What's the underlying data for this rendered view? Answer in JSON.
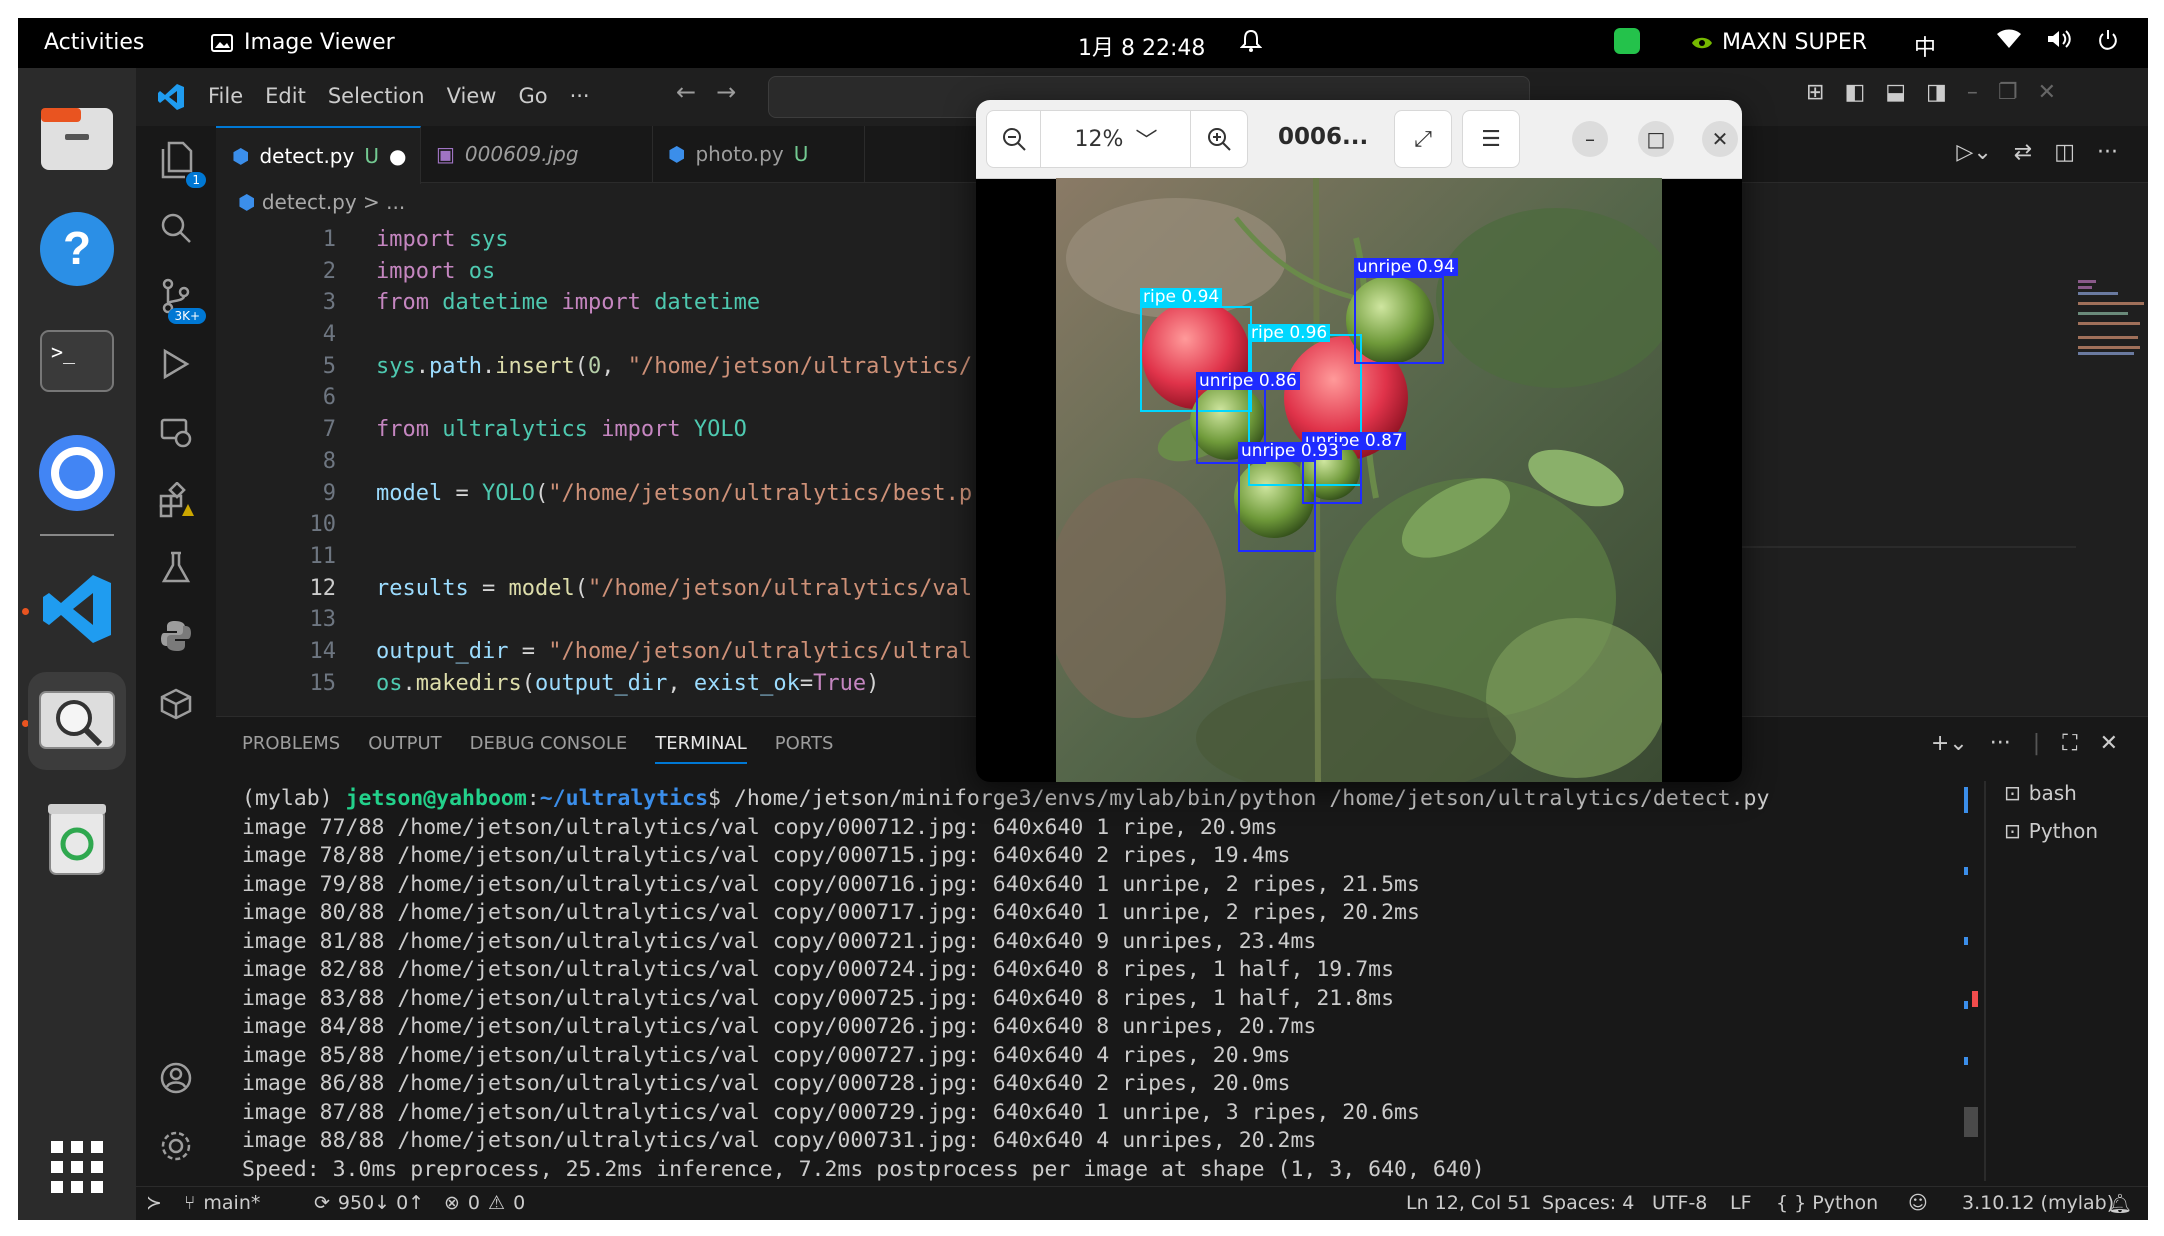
{
  "topbar": {
    "activities": "Activities",
    "app_name": "Image Viewer",
    "clock": "1月 8 22:48",
    "power_mode": "MAXN SUPER",
    "ime": "中"
  },
  "vscode": {
    "menu": [
      "File",
      "Edit",
      "Selection",
      "View",
      "Go",
      "···"
    ],
    "tabs": [
      {
        "label": "detect.py",
        "mod": "U",
        "dirty": "●"
      },
      {
        "label": "000609.jpg",
        "mod": "",
        "dirty": ""
      },
      {
        "label": "photo.py",
        "mod": "U",
        "dirty": ""
      }
    ],
    "breadcrumb": "detect.py > ...",
    "activity_badges": {
      "explorer": "1",
      "scm": "3K+"
    },
    "code_lines": [
      {
        "n": "1",
        "parts": [
          [
            "kw",
            "import"
          ],
          [
            "txt",
            " "
          ],
          [
            "cl",
            "sys"
          ]
        ]
      },
      {
        "n": "2",
        "parts": [
          [
            "kw",
            "import"
          ],
          [
            "txt",
            " "
          ],
          [
            "cl",
            "os"
          ]
        ]
      },
      {
        "n": "3",
        "parts": [
          [
            "kw",
            "from"
          ],
          [
            "txt",
            " "
          ],
          [
            "cl",
            "datetime"
          ],
          [
            "txt",
            " "
          ],
          [
            "kw",
            "import"
          ],
          [
            "txt",
            " "
          ],
          [
            "cl",
            "datetime"
          ]
        ]
      },
      {
        "n": "4",
        "parts": []
      },
      {
        "n": "5",
        "parts": [
          [
            "cl",
            "sys"
          ],
          [
            "txt",
            "."
          ],
          [
            "id",
            "path"
          ],
          [
            "txt",
            "."
          ],
          [
            "fn",
            "insert"
          ],
          [
            "txt",
            "("
          ],
          [
            "nm",
            "0"
          ],
          [
            "txt",
            ", "
          ],
          [
            "st",
            "\"/home/jetson/ultralytics/"
          ]
        ]
      },
      {
        "n": "6",
        "parts": []
      },
      {
        "n": "7",
        "parts": [
          [
            "kw",
            "from"
          ],
          [
            "txt",
            " "
          ],
          [
            "cl",
            "ultralytics"
          ],
          [
            "txt",
            " "
          ],
          [
            "kw",
            "import"
          ],
          [
            "txt",
            " "
          ],
          [
            "cl",
            "YOLO"
          ]
        ]
      },
      {
        "n": "8",
        "parts": []
      },
      {
        "n": "9",
        "parts": [
          [
            "id",
            "model"
          ],
          [
            "txt",
            " = "
          ],
          [
            "cl",
            "YOLO"
          ],
          [
            "txt",
            "("
          ],
          [
            "st",
            "\"/home/jetson/ultralytics/best.p"
          ]
        ]
      },
      {
        "n": "10",
        "parts": []
      },
      {
        "n": "11",
        "parts": []
      },
      {
        "n": "12",
        "parts": [
          [
            "id",
            "results"
          ],
          [
            "txt",
            " = "
          ],
          [
            "fn",
            "model"
          ],
          [
            "txt",
            "("
          ],
          [
            "st",
            "\"/home/jetson/ultralytics/val"
          ]
        ]
      },
      {
        "n": "13",
        "parts": []
      },
      {
        "n": "14",
        "parts": [
          [
            "id",
            "output_dir"
          ],
          [
            "txt",
            " = "
          ],
          [
            "st",
            "\"/home/jetson/ultralytics/ultral"
          ]
        ]
      },
      {
        "n": "15",
        "parts": [
          [
            "cl",
            "os"
          ],
          [
            "txt",
            "."
          ],
          [
            "fn",
            "makedirs"
          ],
          [
            "txt",
            "("
          ],
          [
            "id",
            "output_dir"
          ],
          [
            "txt",
            ", "
          ],
          [
            "id",
            "exist_ok"
          ],
          [
            "txt",
            "="
          ],
          [
            "kw",
            "True"
          ],
          [
            "txt",
            ")"
          ]
        ]
      }
    ],
    "current_line": "12",
    "panel_tabs": [
      "PROBLEMS",
      "OUTPUT",
      "DEBUG CONSOLE",
      "TERMINAL",
      "PORTS"
    ],
    "active_panel_tab": "TERMINAL",
    "terminal": {
      "prompt_env": "(mylab) ",
      "prompt_user": "jetson@yahboom",
      "prompt_sep": ":",
      "prompt_path": "~/ultralytics",
      "command": "$ /home/jetson/miniforge3/envs/mylab/bin/python /home/jetson/ultralytics/detect.py",
      "lines": [
        "image 77/88 /home/jetson/ultralytics/val copy/000712.jpg: 640x640 1 ripe, 20.9ms",
        "image 78/88 /home/jetson/ultralytics/val copy/000715.jpg: 640x640 2 ripes, 19.4ms",
        "image 79/88 /home/jetson/ultralytics/val copy/000716.jpg: 640x640 1 unripe, 2 ripes, 21.5ms",
        "image 80/88 /home/jetson/ultralytics/val copy/000717.jpg: 640x640 1 unripe, 2 ripes, 20.2ms",
        "image 81/88 /home/jetson/ultralytics/val copy/000721.jpg: 640x640 9 unripes, 23.4ms",
        "image 82/88 /home/jetson/ultralytics/val copy/000724.jpg: 640x640 8 ripes, 1 half, 19.7ms",
        "image 83/88 /home/jetson/ultralytics/val copy/000725.jpg: 640x640 8 ripes, 1 half, 21.8ms",
        "image 84/88 /home/jetson/ultralytics/val copy/000726.jpg: 640x640 8 unripes, 20.7ms",
        "image 85/88 /home/jetson/ultralytics/val copy/000727.jpg: 640x640 4 ripes, 20.9ms",
        "image 86/88 /home/jetson/ultralytics/val copy/000728.jpg: 640x640 2 ripes, 20.0ms",
        "image 87/88 /home/jetson/ultralytics/val copy/000729.jpg: 640x640 1 unripe, 3 ripes, 20.6ms",
        "image 88/88 /home/jetson/ultralytics/val copy/000731.jpg: 640x640 4 unripes, 20.2ms",
        "Speed: 3.0ms preprocess, 25.2ms inference, 7.2ms postprocess per image at shape (1, 3, 640, 640)"
      ]
    },
    "terminal_list": [
      "bash",
      "Python"
    ],
    "status": {
      "branch": "main*",
      "sync": "950↓ 0↑",
      "problems": "0",
      "warnings": "0",
      "position": "Ln 12, Col 51",
      "spaces": "Spaces: 4",
      "encoding": "UTF-8",
      "eol": "LF",
      "language": "{ } Python",
      "interpreter": "3.10.12 (mylab)"
    }
  },
  "viewer": {
    "zoom": "12%",
    "title": "0006...",
    "detections": [
      {
        "label": "ripe 0.94",
        "color": "#00d7ff"
      },
      {
        "label": "ripe 0.96",
        "color": "#00d7ff"
      },
      {
        "label": "unripe 0.94",
        "color": "#1f2bff"
      },
      {
        "label": "unripe 0.86",
        "color": "#1f2bff"
      },
      {
        "label": "unripe 0.87",
        "color": "#1f2bff"
      },
      {
        "label": "unripe 0.93",
        "color": "#1f2bff"
      }
    ]
  }
}
